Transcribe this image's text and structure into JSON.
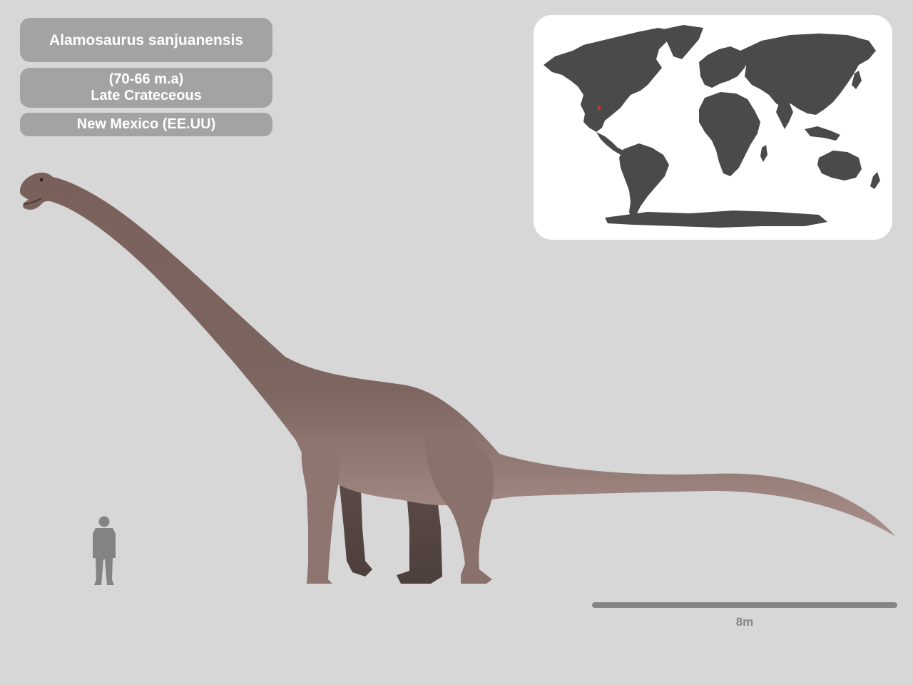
{
  "species": {
    "name": "Alamosaurus sanjuanensis",
    "age_range": "(70-66 m.a)",
    "period": "Late Crateceous",
    "location": "New Mexico (EE.UU)"
  },
  "scale": {
    "label": "8m"
  },
  "map": {
    "land_color": "#4a4a4a",
    "marker_color": "#c0392b"
  },
  "colors": {
    "background": "#d7d7d7",
    "label_pill": "#a3a3a3",
    "dinosaur_body": "#7d6660",
    "human_silhouette": "#838383",
    "scale_bar": "#848484"
  }
}
